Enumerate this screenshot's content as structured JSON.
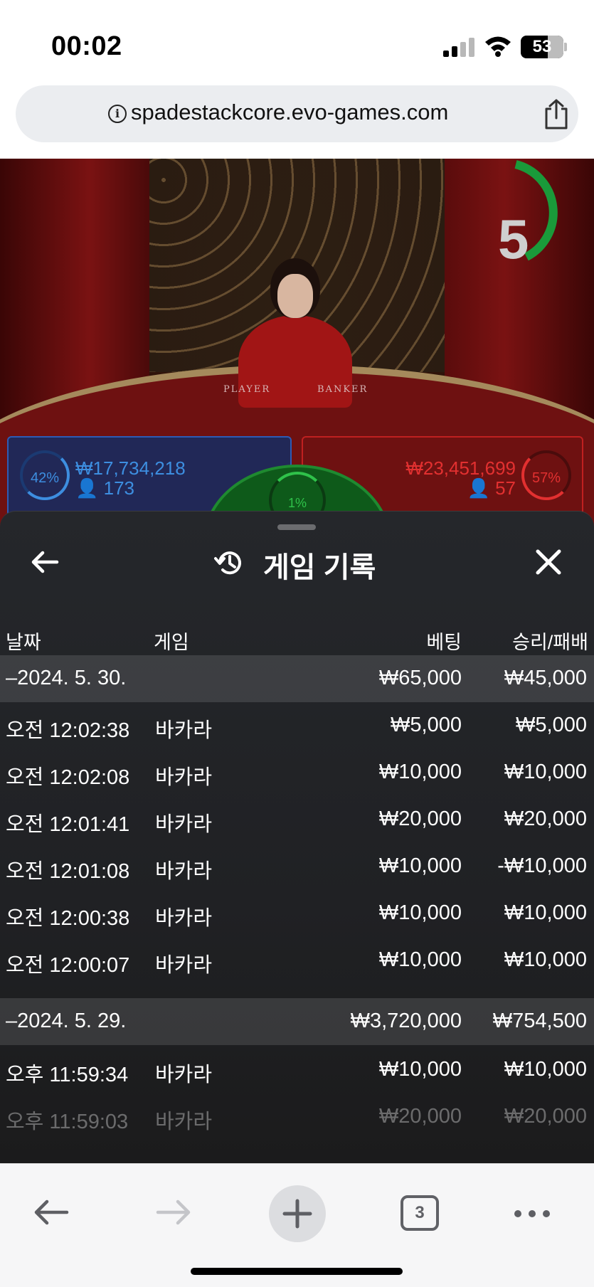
{
  "status_bar": {
    "time": "00:02",
    "battery": "53"
  },
  "browser": {
    "url": "spadestackcore.evo-games.com",
    "tab_count": "3"
  },
  "game_overlay": {
    "timer": "5",
    "table_labels": {
      "player": "PLAYER",
      "banker": "BANKER"
    },
    "player": {
      "percent": "42%",
      "amount": "₩17,734,218",
      "count": "173",
      "color": "#3d8ee0"
    },
    "banker": {
      "percent": "57%",
      "amount": "₩23,451,699",
      "count": "57",
      "color": "#e23030"
    },
    "tie": {
      "percent": "1%",
      "color": "#2fc24a"
    }
  },
  "panel": {
    "title": "게임 기록",
    "columns": {
      "date": "날짜",
      "game": "게임",
      "bet": "베팅",
      "win_loss": "승리/패배"
    },
    "groups": [
      {
        "date": "–2024. 5. 30.",
        "bet": "₩65,000",
        "win_loss": "₩45,000",
        "rows": [
          {
            "time": "오전 12:02:38",
            "game": "바카라",
            "bet": "₩5,000",
            "win_loss": "₩5,000"
          },
          {
            "time": "오전 12:02:08",
            "game": "바카라",
            "bet": "₩10,000",
            "win_loss": "₩10,000"
          },
          {
            "time": "오전 12:01:41",
            "game": "바카라",
            "bet": "₩20,000",
            "win_loss": "₩20,000"
          },
          {
            "time": "오전 12:01:08",
            "game": "바카라",
            "bet": "₩10,000",
            "win_loss": "-₩10,000"
          },
          {
            "time": "오전 12:00:38",
            "game": "바카라",
            "bet": "₩10,000",
            "win_loss": "₩10,000"
          },
          {
            "time": "오전 12:00:07",
            "game": "바카라",
            "bet": "₩10,000",
            "win_loss": "₩10,000"
          }
        ]
      },
      {
        "date": "–2024. 5. 29.",
        "bet": "₩3,720,000",
        "win_loss": "₩754,500",
        "rows": [
          {
            "time": "오후 11:59:34",
            "game": "바카라",
            "bet": "₩10,000",
            "win_loss": "₩10,000"
          },
          {
            "time": "오후 11:59:03",
            "game": "바카라",
            "bet": "₩20,000",
            "win_loss": "₩20,000"
          }
        ]
      }
    ]
  }
}
